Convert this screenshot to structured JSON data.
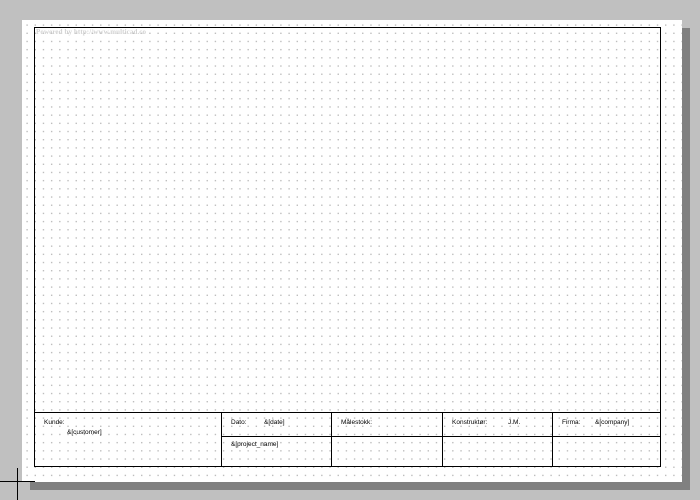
{
  "watermark": "Powered by http://www.multicad.co",
  "title_block": {
    "customer": {
      "label": "Kunde:",
      "value": "&[customer]"
    },
    "date": {
      "label": "Dato:",
      "value": "&[date]"
    },
    "project": {
      "value": "&[project_name]"
    },
    "scale": {
      "label": "Målestokk:",
      "value": ""
    },
    "designer": {
      "label": "Konstruktør:",
      "value": "J.M."
    },
    "company": {
      "label": "Firma:",
      "value": "&[company]"
    }
  },
  "colors": {
    "background": "#c0c0c0",
    "sheet": "#ffffff",
    "shadow": "#808080",
    "grid_dot": "#b9b9b9",
    "line": "#000000"
  }
}
